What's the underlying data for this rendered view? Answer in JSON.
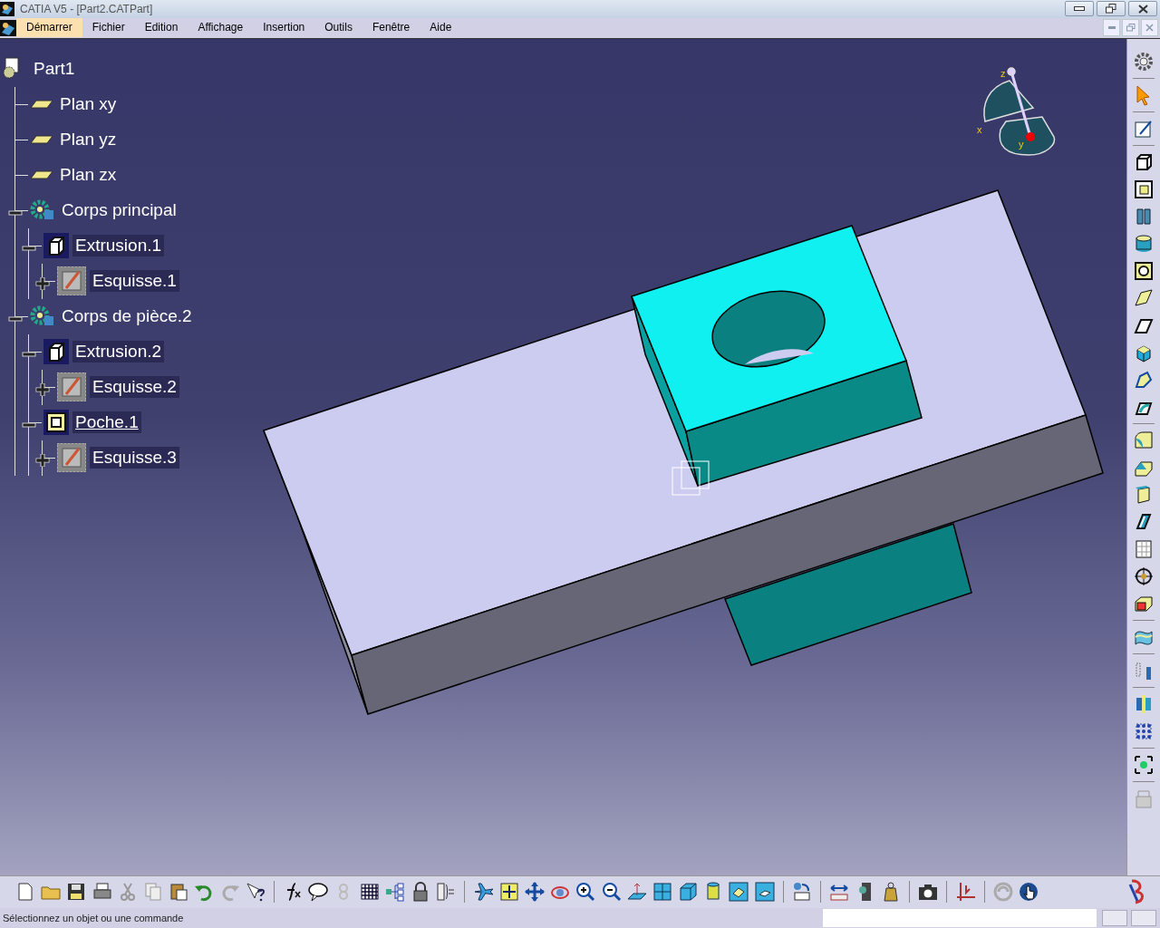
{
  "window": {
    "title": "CATIA V5 - [Part2.CATPart]"
  },
  "menu": [
    {
      "label": "Démarrer",
      "selected": true
    },
    {
      "label": "Fichier",
      "selected": false
    },
    {
      "label": "Edition",
      "selected": false
    },
    {
      "label": "Affichage",
      "selected": false
    },
    {
      "label": "Insertion",
      "selected": false
    },
    {
      "label": "Outils",
      "selected": false
    },
    {
      "label": "Fenêtre",
      "selected": false
    },
    {
      "label": "Aide",
      "selected": false
    }
  ],
  "tree": {
    "label": "Part1",
    "kind": "part",
    "in_work": false,
    "children": [
      {
        "label": "Plan xy",
        "kind": "plane",
        "in_work": false
      },
      {
        "label": "Plan yz",
        "kind": "plane",
        "in_work": false
      },
      {
        "label": "Plan zx",
        "kind": "plane",
        "in_work": false
      },
      {
        "label": "Corps principal",
        "kind": "body",
        "in_work": false,
        "expanded": true,
        "children": [
          {
            "label": "Extrusion.1",
            "kind": "pad",
            "in_work": false,
            "expanded": true,
            "children": [
              {
                "label": "Esquisse.1",
                "kind": "sketch",
                "in_work": false,
                "expanded": false
              }
            ]
          }
        ]
      },
      {
        "label": "Corps de pièce.2",
        "kind": "body",
        "in_work": false,
        "expanded": true,
        "children": [
          {
            "label": "Extrusion.2",
            "kind": "pad",
            "in_work": false,
            "expanded": true,
            "children": [
              {
                "label": "Esquisse.2",
                "kind": "sketch",
                "in_work": false,
                "expanded": false
              }
            ]
          },
          {
            "label": "Poche.1",
            "kind": "pocket",
            "in_work": true,
            "expanded": true,
            "children": [
              {
                "label": "Esquisse.3",
                "kind": "sketch",
                "in_work": false,
                "expanded": false
              }
            ]
          }
        ]
      }
    ]
  },
  "compass": {
    "axis_labels": [
      "x",
      "y",
      "z"
    ]
  },
  "status_bar": {
    "message": "Sélectionnez un objet ou une commande"
  }
}
